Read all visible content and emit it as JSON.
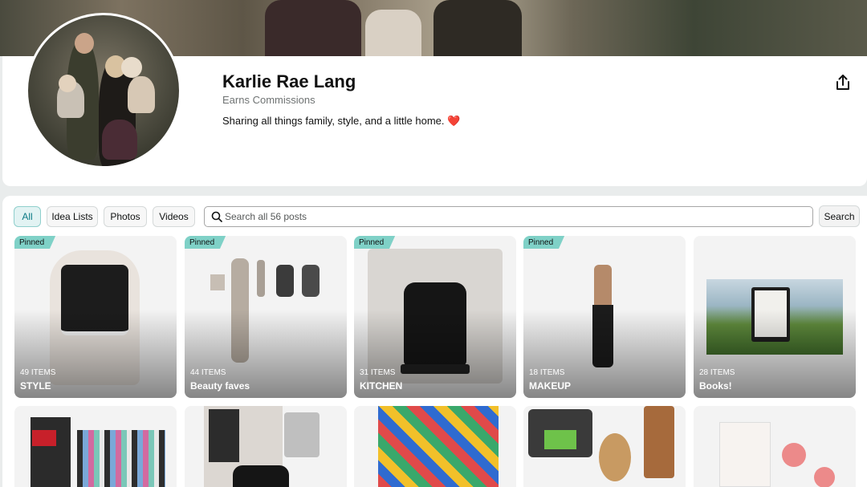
{
  "profile": {
    "name": "Karlie Rae Lang",
    "subtitle": "Earns Commissions",
    "bio": "Sharing all things family, style, and a little home.",
    "bio_emoji": "❤️"
  },
  "filters": [
    "All",
    "Idea Lists",
    "Photos",
    "Videos"
  ],
  "active_filter": "All",
  "search": {
    "placeholder": "Search all 56 posts",
    "button_label": "Search"
  },
  "cards": [
    {
      "pinned": "Pinned",
      "count": "49 ITEMS",
      "title": "STYLE"
    },
    {
      "pinned": "Pinned",
      "count": "44 ITEMS",
      "title": "Beauty faves"
    },
    {
      "pinned": "Pinned",
      "count": "31 ITEMS",
      "title": "KITCHEN"
    },
    {
      "pinned": "Pinned",
      "count": "18 ITEMS",
      "title": "MAKEUP"
    },
    {
      "pinned": "",
      "count": "28 ITEMS",
      "title": "Books!"
    }
  ],
  "icons": {
    "share": "share-icon",
    "search": "search-icon"
  },
  "colors": {
    "accent": "#7fd1c7",
    "active_filter_text": "#0b7a85",
    "heart": "#d0212c"
  }
}
